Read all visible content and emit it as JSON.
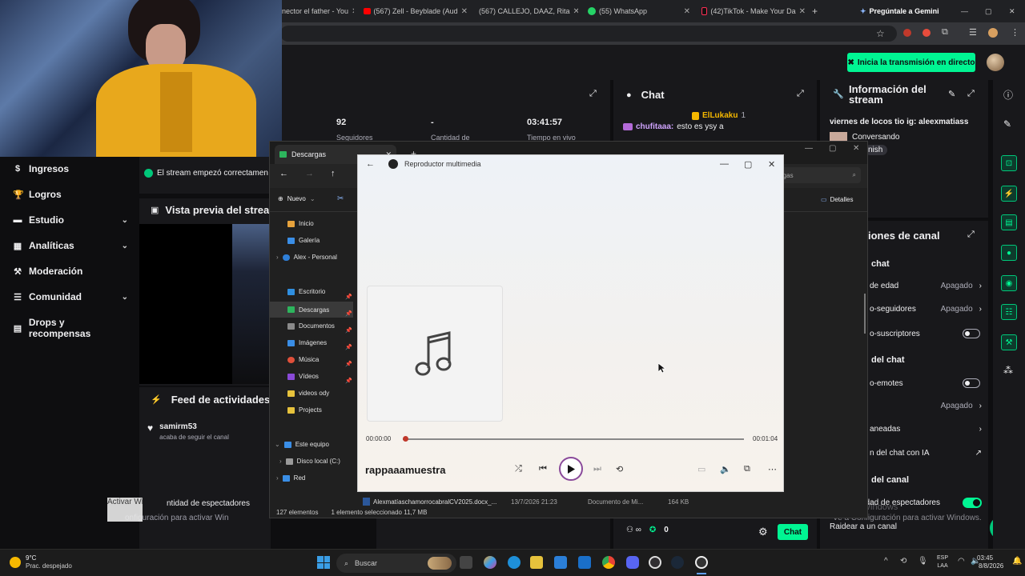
{
  "browser": {
    "tabs": [
      {
        "label": "nector el father - You"
      },
      {
        "label": "(567) Zell - Beyblade (Aud"
      },
      {
        "label": "(567) CALLEJO, DAAZ, Rita"
      },
      {
        "label": "(55) WhatsApp"
      },
      {
        "label": "(42)TikTok - Make Your Da"
      }
    ],
    "new_tab": "+",
    "gemini": "Pregúntale a Gemini"
  },
  "twitch": {
    "go_live": "Inicia la transmisión en directo",
    "stats": [
      {
        "value": "92",
        "label": "Seguidores"
      },
      {
        "value": "-",
        "label": "Cantidad de"
      },
      {
        "value": "03:41:57",
        "label": "Tiempo en vivo"
      }
    ],
    "stream_started": "El stream empezó correctamen",
    "preview_title": "Vista previa del strea",
    "activity_title": "Feed de actividades",
    "activity_user": "samirm53",
    "activity_text": "acaba de seguir el canal",
    "viewers_setting": "ntidad de espectadores",
    "config_activate": "onfiguración para activar Win",
    "activate_windows": "Activar Windows",
    "nav": [
      {
        "label": "Ingresos",
        "icon": "$",
        "chevron": false
      },
      {
        "label": "Logros",
        "icon": "🏆",
        "chevron": false
      },
      {
        "label": "Estudio",
        "icon": "▬",
        "chevron": true
      },
      {
        "label": "Analíticas",
        "icon": "▦",
        "chevron": true
      },
      {
        "label": "Moderación",
        "icon": "⚒",
        "chevron": false
      },
      {
        "label": "Comunidad",
        "icon": "☰",
        "chevron": true
      },
      {
        "label": "Drops y recompensas",
        "icon": "▤",
        "chevron": false
      }
    ],
    "chat": {
      "title": "Chat",
      "pinned_user": "ElLukaku",
      "pinned_count": "1",
      "msg_user": "chufitaaa:",
      "msg_text": "esto es ysy a",
      "footer_count": "0",
      "chat_button": "Chat"
    },
    "info": {
      "title_line1": "Información del",
      "title_line2": "stream",
      "stream_title": "viernes de locos tio ig: aleexmatiass",
      "category": "Conversando",
      "tag": "nish"
    },
    "settings": {
      "title": "iones de canal",
      "rows": [
        {
          "label": "chat",
          "type": "header"
        },
        {
          "label": "de edad",
          "value": "Apagado",
          "type": "select"
        },
        {
          "label": "o-seguidores",
          "value": "Apagado",
          "type": "select"
        },
        {
          "label": "o-suscriptores",
          "type": "toggle-off"
        },
        {
          "label": "del chat",
          "type": "header"
        },
        {
          "label": "o-emotes",
          "type": "toggle-off"
        },
        {
          "label": "",
          "value": "Apagado",
          "type": "select"
        },
        {
          "label": "aneadas",
          "type": "arrow"
        },
        {
          "label": "n del chat con IA",
          "type": "link"
        },
        {
          "label": "del canal",
          "type": "header"
        },
        {
          "label": "ntidad de espectadores",
          "type": "toggle-on"
        }
      ],
      "raid": "Raidear a un canal",
      "activate_line1": "Activar Windows",
      "activate_line2": "Ve a Configuración para activar Windows."
    }
  },
  "explorer": {
    "tab_title": "Descargas",
    "new_button": "Nuevo",
    "search_placeholder": "rgas",
    "details": "Detalles",
    "sidebar": [
      {
        "label": "Inicio",
        "color": "#e6a23c"
      },
      {
        "label": "Galería",
        "color": "#3a8ee6"
      },
      {
        "label": "Alex - Personal",
        "color": "#2f7fd8"
      },
      {
        "label": "Escritorio",
        "color": "#2f8fe0"
      },
      {
        "label": "Descargas",
        "color": "#2db55d"
      },
      {
        "label": "Documentos",
        "color": "#8a8a8a"
      },
      {
        "label": "Imágenes",
        "color": "#3a8ee6"
      },
      {
        "label": "Música",
        "color": "#e0503a"
      },
      {
        "label": "Vídeos",
        "color": "#8a4ad8"
      },
      {
        "label": "videos ody",
        "color": "#e6c23c"
      },
      {
        "label": "Projects",
        "color": "#e6c23c"
      },
      {
        "label": "Este equipo",
        "color": "#3a8ee6"
      },
      {
        "label": "Disco local (C:)",
        "color": "#9a9a9a"
      },
      {
        "label": "Red",
        "color": "#3a8ee6"
      }
    ],
    "file_row": {
      "name": "Alexmatíaschamorrocabra​lCV2025.docx_...",
      "date": "13/7/2026 21:23",
      "type": "Documento de Mi...",
      "size": "164 KB"
    },
    "status_count": "127 elementos",
    "status_selected": "1 elemento seleccionado  11,7 MB"
  },
  "player": {
    "title": "Reproductor multimedia",
    "track": "rappaaamuestra",
    "time_current": "00:00:00",
    "time_total": "00:01:04",
    "progress": 0.0
  },
  "taskbar": {
    "weather_temp": "9°C",
    "weather_desc": "Prac. despejado",
    "search": "Buscar",
    "lang_line1": "ESP",
    "lang_line2": "LAA",
    "time": "03:45",
    "date": "8/8/2026"
  }
}
